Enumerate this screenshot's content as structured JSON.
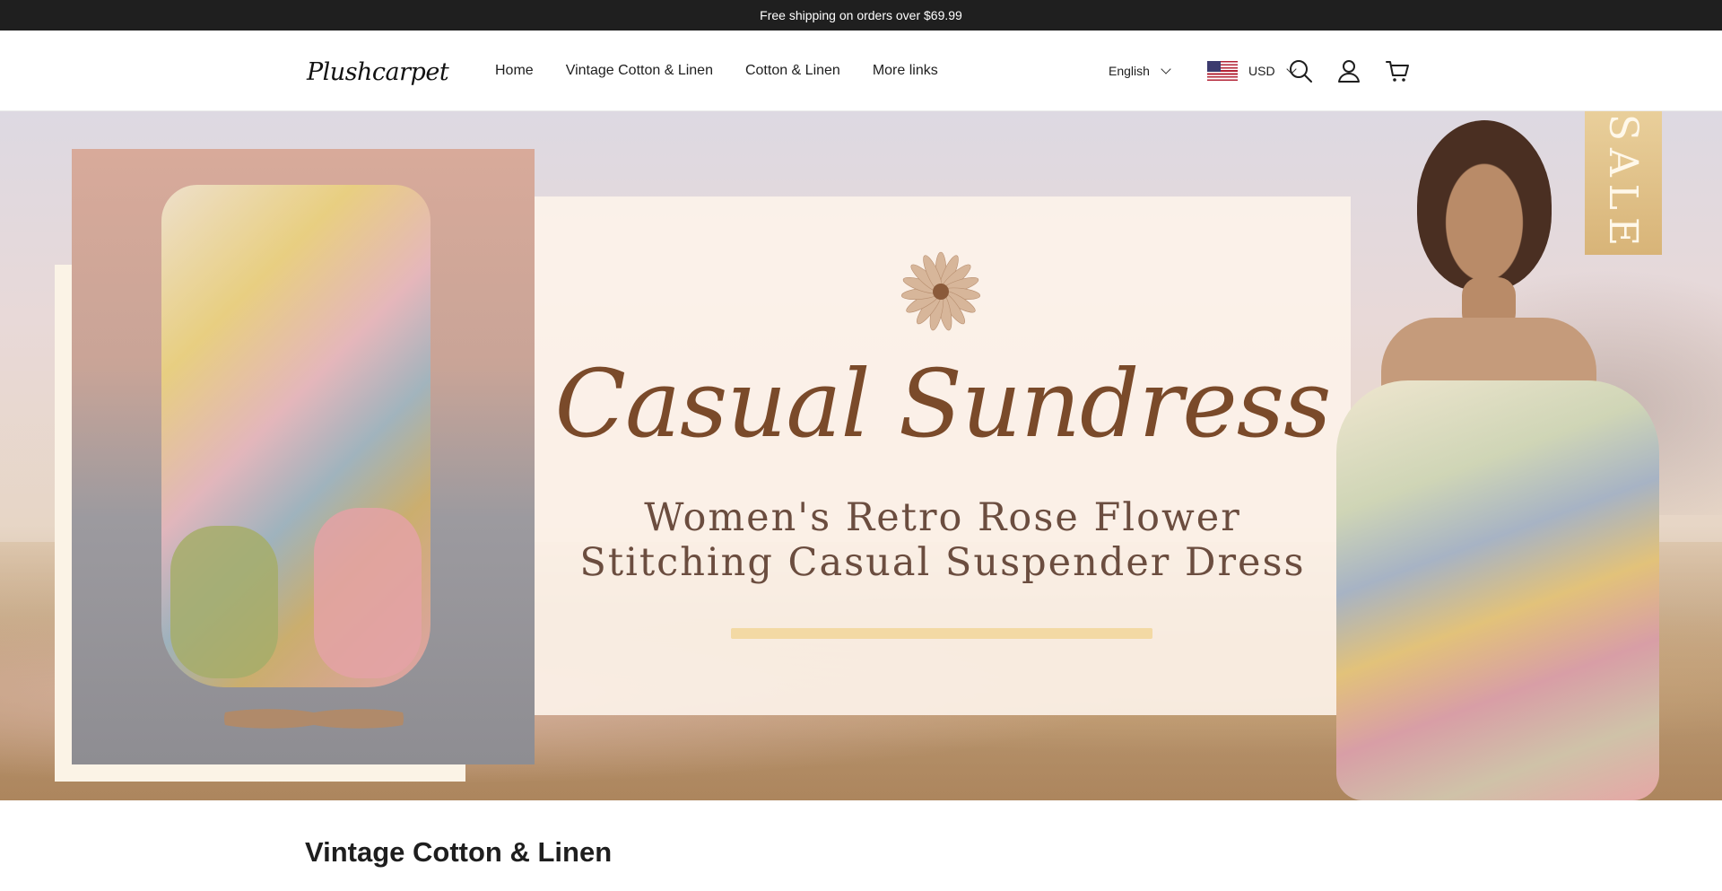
{
  "announcement": {
    "text": "Free shipping on orders over $69.99"
  },
  "brand": {
    "name": "Plushcarpet"
  },
  "nav": {
    "items": [
      {
        "label": "Home"
      },
      {
        "label": "Vintage Cotton & Linen"
      },
      {
        "label": "Cotton & Linen"
      },
      {
        "label": "More links"
      }
    ]
  },
  "language": {
    "selected": "English"
  },
  "currency": {
    "selected": "USD"
  },
  "hero": {
    "title": "Casual Sundress",
    "subtitle_line1": "Women's Retro Rose Flower",
    "subtitle_line2": "Stitching Casual Suspender Dress",
    "tag": "SALE"
  },
  "section": {
    "title": "Vintage Cotton & Linen"
  },
  "icons": {
    "search": "search-icon",
    "account": "user-icon",
    "cart": "cart-icon",
    "flag": "us-flag-icon",
    "flower": "daisy-icon"
  },
  "colors": {
    "announcement_bg": "#1f1f1f",
    "title_brown": "#7a4a2a",
    "panel_cream": "#fdf3ea"
  }
}
